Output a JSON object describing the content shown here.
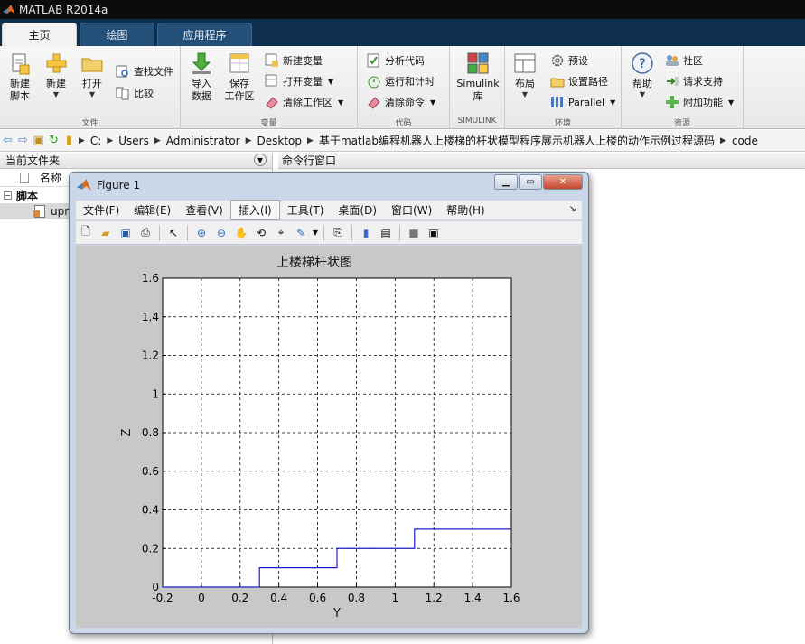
{
  "window": {
    "title": "MATLAB R2014a"
  },
  "tabs": [
    {
      "label": "主页",
      "active": true
    },
    {
      "label": "绘图",
      "active": false
    },
    {
      "label": "应用程序",
      "active": false
    }
  ],
  "ribbon": {
    "file": {
      "label": "文件",
      "new_script": "新建\n脚本",
      "new": "新建",
      "open": "打开",
      "find_files": "查找文件",
      "compare": "比较"
    },
    "variable": {
      "label": "变量",
      "import": "导入\n数据",
      "save": "保存\n工作区",
      "new_var": "新建变量",
      "open_var": "打开变量",
      "clear_ws": "清除工作区"
    },
    "code": {
      "label": "代码",
      "analyze": "分析代码",
      "run_time": "运行和计时",
      "clear_cmd": "清除命令"
    },
    "simulink": {
      "label": "SIMULINK",
      "lib": "Simulink\n库"
    },
    "env": {
      "label": "环境",
      "layout": "布局",
      "prefs": "预设",
      "set_path": "设置路径",
      "parallel": "Parallel"
    },
    "resources": {
      "label": "资源",
      "help": "帮助",
      "community": "社区",
      "support": "请求支持",
      "addons": "附加功能"
    }
  },
  "address": {
    "crumbs": [
      "C:",
      "Users",
      "Administrator",
      "Desktop",
      "基于matlab编程机器人上楼梯的杆状模型程序展示机器人上楼的动作示例过程源码",
      "code"
    ]
  },
  "current_folder": {
    "title": "当前文件夹",
    "col_name": "名称",
    "group": "脚本",
    "file": "upr"
  },
  "command_window": {
    "title": "命令行窗口"
  },
  "figure": {
    "title": "Figure 1",
    "menus": [
      "文件(F)",
      "编辑(E)",
      "查看(V)",
      "插入(I)",
      "工具(T)",
      "桌面(D)",
      "窗口(W)",
      "帮助(H)"
    ],
    "selected_menu": "插入(I)"
  },
  "colors": {
    "plot_line": "#1f1fc8",
    "tab_bg": "#0f2d4c",
    "ribbon_bg": "#f0f0f0"
  },
  "chart_data": {
    "type": "line",
    "title": "上楼梯杆状图",
    "xlabel": "Y",
    "ylabel": "Z",
    "xlim": [
      -0.2,
      1.6
    ],
    "ylim": [
      0,
      1.6
    ],
    "xticks": [
      "-0.2",
      "0",
      "0.2",
      "0.4",
      "0.6",
      "0.8",
      "1",
      "1.2",
      "1.4",
      "1.6"
    ],
    "yticks": [
      "0",
      "0.2",
      "0.4",
      "0.6",
      "0.8",
      "1",
      "1.2",
      "1.4",
      "1.6"
    ],
    "grid": true,
    "series": [
      {
        "x": [
          -0.2,
          0.3,
          0.3,
          0.7,
          0.7,
          1.1,
          1.1,
          1.6
        ],
        "y": [
          0,
          0,
          0.1,
          0.1,
          0.2,
          0.2,
          0.3,
          0.3
        ]
      }
    ]
  }
}
